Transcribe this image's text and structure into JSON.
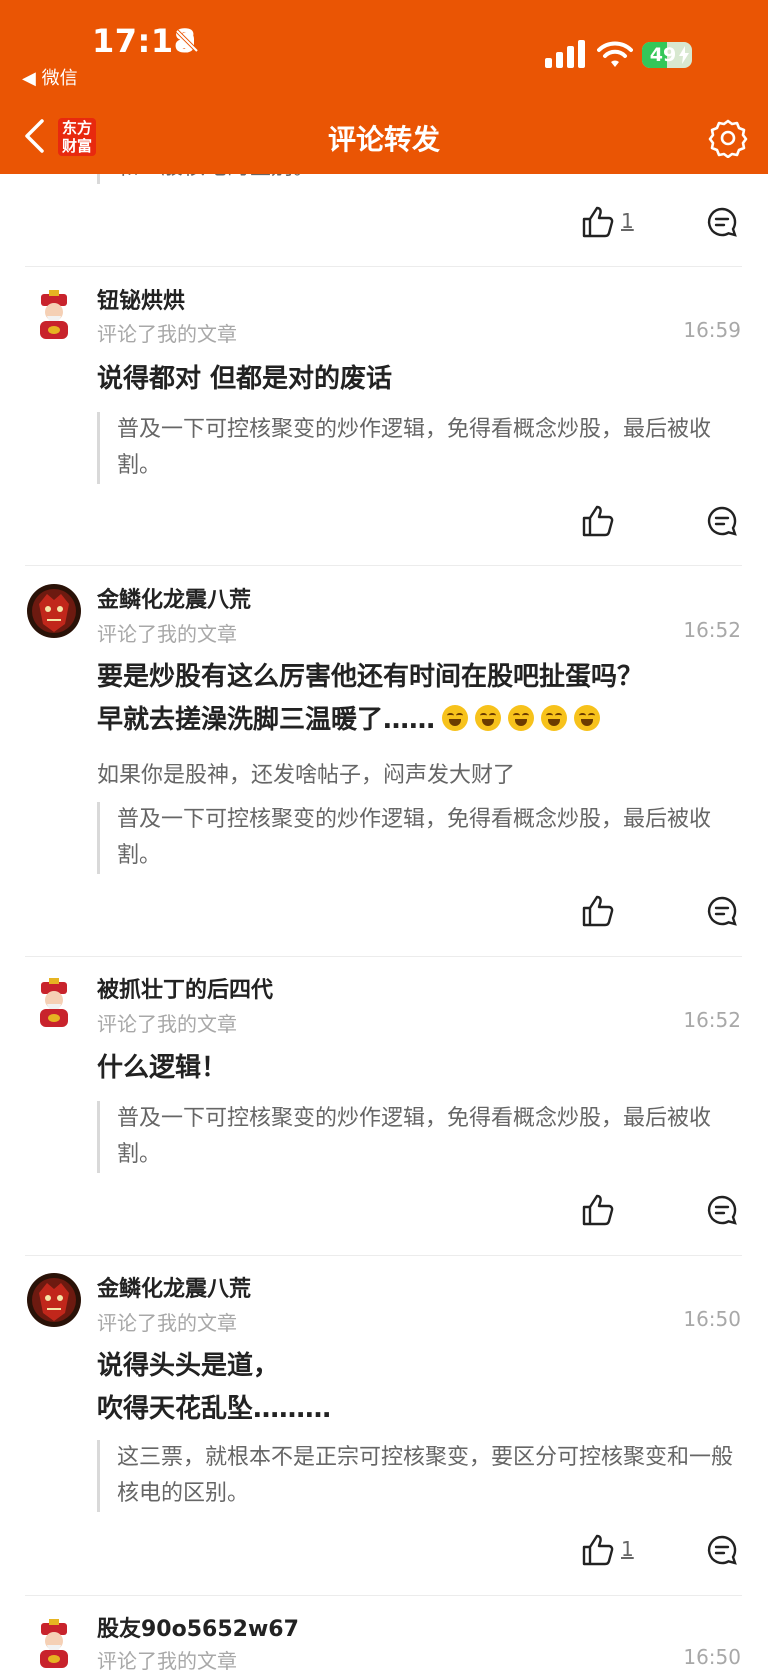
{
  "status_bar": {
    "time": "17:18",
    "back_app": "◀ 微信",
    "battery_level": "49",
    "battery_fraction": 0.49
  },
  "nav": {
    "logo_line1": "东方",
    "logo_line2": "财富",
    "title": "评论转发"
  },
  "colors": {
    "brand_orange": "#ea5504",
    "logo_red": "#e8290e"
  },
  "comments": [
    {
      "partial_quote": "和一般核电的区别。",
      "likes": "1"
    },
    {
      "user": "钮铋烘烘",
      "avatar": "caishen-avatar",
      "action": "评论了我的文章",
      "time": "16:59",
      "text": "说得都对  但都是对的废话",
      "quote": "普及一下可控核聚变的炒作逻辑，免得看概念炒股，最后被收割。"
    },
    {
      "user": "金鳞化龙震八荒",
      "avatar": "red-mask-avatar",
      "action": "评论了我的文章",
      "time": "16:52",
      "text_line1": "要是炒股有这么厉害他还有时间在股吧扯蛋吗？",
      "text_line2": "早就去搓澡洗脚三温暖了……",
      "emoji_count": 5,
      "subtext": "如果你是股神，还发啥帖子，闷声发大财了",
      "quote": "普及一下可控核聚变的炒作逻辑，免得看概念炒股，最后被收割。"
    },
    {
      "user": "被抓壮丁的后四代",
      "avatar": "caishen-avatar",
      "action": "评论了我的文章",
      "time": "16:52",
      "text": "什么逻辑！",
      "quote": "普及一下可控核聚变的炒作逻辑，免得看概念炒股，最后被收割。"
    },
    {
      "user": "金鳞化龙震八荒",
      "avatar": "red-mask-avatar",
      "action": "评论了我的文章",
      "time": "16:50",
      "text_line1": "说得头头是道，",
      "text_line2": "吹得天花乱坠………",
      "quote": "这三票，就根本不是正宗可控核聚变，要区分可控核聚变和一般核电的区别。",
      "likes": "1"
    },
    {
      "user": "股友90o5652w67",
      "avatar": "caishen-avatar",
      "action": "评论了我的文章",
      "time": "16:50"
    }
  ]
}
